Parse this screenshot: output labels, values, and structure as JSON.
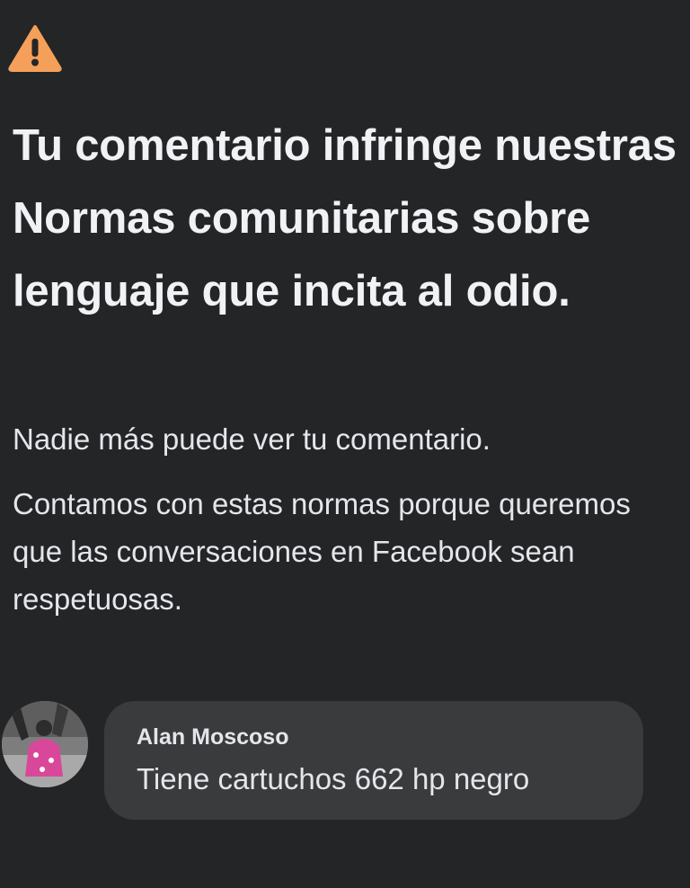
{
  "alert": {
    "icon": "warning-triangle-icon",
    "icon_color": "#f5a05a",
    "headline": "Tu comentario infringe nuestras Normas comunitarias sobre lenguaje que incita al odio.",
    "visibility_text": "Nadie más puede ver tu comentario.",
    "explanation_text": "Contamos con estas normas porque queremos que las conversaciones en Facebook sean respetuosas."
  },
  "comment": {
    "author": "Alan Moscoso",
    "text": "Tiene cartuchos 662 hp negro",
    "avatar": "user-avatar-photo"
  },
  "colors": {
    "background": "#242526",
    "bubble": "#3a3b3c",
    "text": "#e4e6eb"
  }
}
